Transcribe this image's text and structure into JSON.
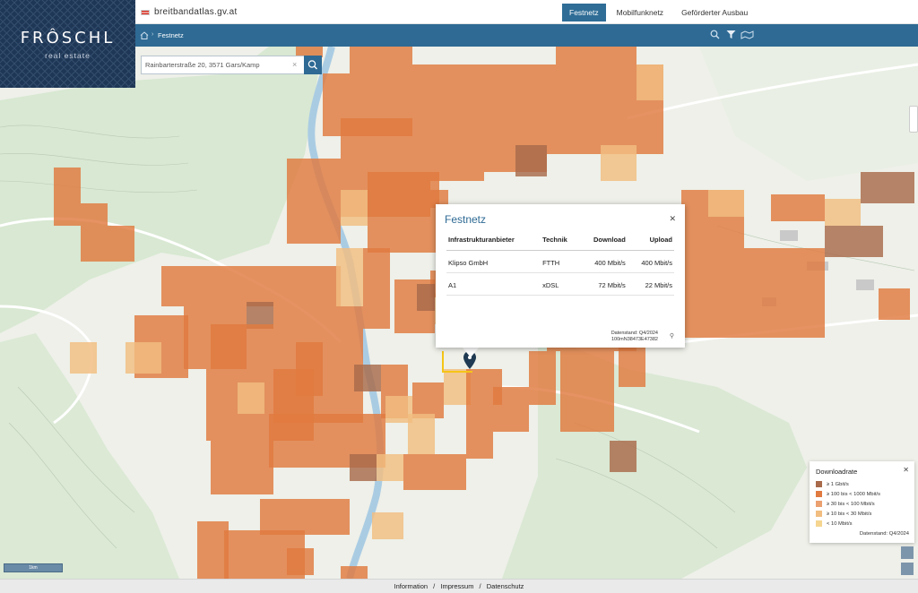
{
  "site": {
    "url": "breitbandatlas.gv.at"
  },
  "nav": {
    "tabs": [
      {
        "label": "Festnetz",
        "active": true
      },
      {
        "label": "Mobilfunknetz",
        "active": false
      },
      {
        "label": "Geförderter Ausbau",
        "active": false
      }
    ]
  },
  "breadcrumb": {
    "current": "Festnetz"
  },
  "logo": {
    "name": "FRÔSCHL",
    "sub": "real estate"
  },
  "search": {
    "value": "Rainbarterstraße 20, 3571 Gars/Kamp"
  },
  "popup": {
    "title": "Festnetz",
    "columns": [
      "Infrastrukturanbieter",
      "Technik",
      "Download",
      "Upload"
    ],
    "rows": [
      [
        "Klipso GmbH",
        "FTTH",
        "400 Mbit/s",
        "400 Mbit/s"
      ],
      [
        "A1",
        "xDSL",
        "72 Mbit/s",
        "22 Mbit/s"
      ]
    ],
    "stand_line1": "Datenstand: Q4/2024",
    "stand_line2": "100mN38473E47382"
  },
  "legend": {
    "title": "Downloadrate",
    "items": [
      {
        "label": "≥ 1 Gbit/s",
        "color": "#a86a4a"
      },
      {
        "label": "≥ 100 bis < 1000 Mbit/s",
        "color": "#e07a40"
      },
      {
        "label": "≥ 30 bis < 100 Mbit/s",
        "color": "#eba070"
      },
      {
        "label": "≥ 10 bis < 30 Mbit/s",
        "color": "#f2bd80"
      },
      {
        "label": "< 10 Mbit/s",
        "color": "#f5d590"
      }
    ],
    "stand": "Datenstand: Q4/2024"
  },
  "footer": {
    "information": "Information",
    "impressum": "Impressum",
    "datenschutz": "Datenschutz",
    "sep": "/"
  },
  "map": {
    "scale_label": "1km"
  },
  "colors": {
    "primary": "#2e6a94",
    "coverage": "#e07a40",
    "coverage_dark": "#a86a4a",
    "coverage_light": "#f2bd80"
  }
}
